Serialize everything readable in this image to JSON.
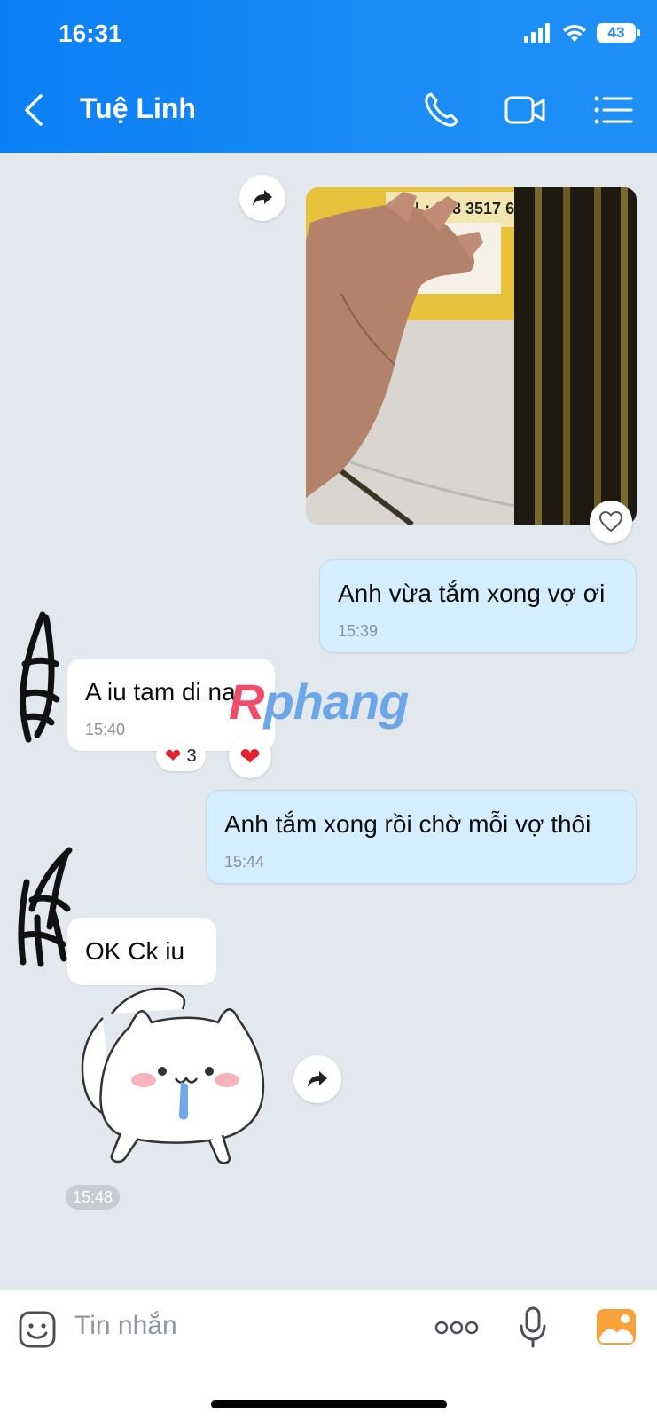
{
  "status_bar": {
    "time": "16:31",
    "battery": "43"
  },
  "header": {
    "title": "Tuệ Linh"
  },
  "watermark": {
    "part1": "R",
    "part2": "phang"
  },
  "messages": [
    {
      "id": "m1",
      "text": "Anh vừa tắm xong vợ ơi",
      "time": "15:39"
    },
    {
      "id": "m2",
      "text": "A iu tam di na",
      "time": "15:40",
      "reaction_count": "3"
    },
    {
      "id": "m3",
      "text": "Anh tắm xong rồi chờ mỗi vợ thôi",
      "time": "15:44"
    },
    {
      "id": "m4",
      "text": "OK Ck iu"
    }
  ],
  "sticker_time": "15:48",
  "photo": {
    "sign_text": "TEL: 028 3517 6050"
  },
  "input": {
    "placeholder": "Tin nhắn"
  },
  "colors": {
    "header_blue": "#1b8cf7",
    "outgoing_bubble": "#d5eeff",
    "incoming_bubble": "#ffffff",
    "chat_bg": "#e3e7ee"
  }
}
